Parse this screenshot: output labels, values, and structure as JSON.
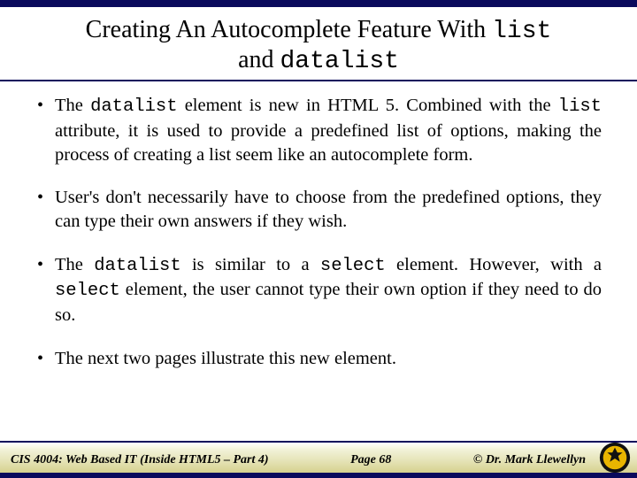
{
  "title": {
    "part1": "Creating An Autocomplete Feature With ",
    "code1": "list",
    "part2": " and ",
    "code2": "datalist"
  },
  "bullets": [
    {
      "pre1": "The ",
      "code1": "datalist",
      "mid1": " element is new in HTML 5.  Combined with the ",
      "code2": "list",
      "post1": " attribute, it is used to provide a predefined list of options, making the process of creating a list seem like an autocomplete form."
    },
    {
      "text": "User's don't necessarily have to choose from the predefined options, they can type their own answers if they wish."
    },
    {
      "pre1": "The ",
      "code1": "datalist",
      "mid1": " is similar to a ",
      "code2": "select",
      "mid2": " element.  However, with a ",
      "code3": "select",
      "post1": " element, the user cannot type their own option if they need to do so."
    },
    {
      "text": "The next two pages illustrate this new element."
    }
  ],
  "footer": {
    "course": "CIS 4004: Web Based IT (Inside HTML5 – Part 4)",
    "page": "Page 68",
    "author": "© Dr. Mark Llewellyn"
  }
}
